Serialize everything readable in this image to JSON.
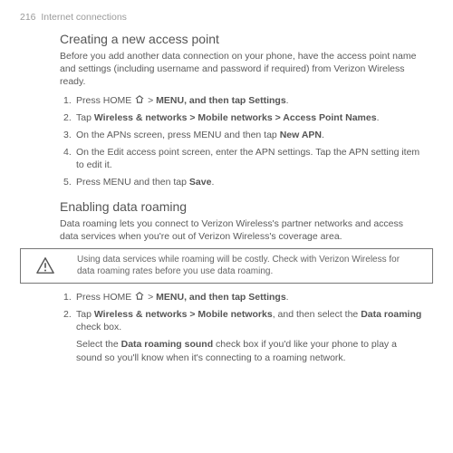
{
  "header": {
    "page_number": "216",
    "section": "Internet connections"
  },
  "s1": {
    "title": "Creating a new access point",
    "desc": "Before you add another data connection on your phone, have the access point name and settings (including username and password if required) from Verizon Wireless ready.",
    "steps": {
      "n1": "1.",
      "t1a": "Press HOME ",
      "t1b": " > ",
      "menu": "MENU, and then tap Settings",
      "t1c": ".",
      "n2": "2.",
      "t2a": "Tap ",
      "path2": "Wireless & networks > Mobile networks > Access Point Names",
      "t2b": ".",
      "n3": "3.",
      "t3a": "On the APNs screen, press MENU and then tap ",
      "newapn": "New APN",
      "t3b": ".",
      "n4": "4.",
      "t4": "On the Edit access point screen, enter the APN settings. Tap the APN setting item to edit it.",
      "n5": "5.",
      "t5a": "Press MENU and then tap ",
      "save": "Save",
      "t5b": "."
    }
  },
  "s2": {
    "title": "Enabling data roaming",
    "desc": "Data roaming lets you connect to Verizon Wireless's partner networks and access data services when you're out of Verizon Wireless's coverage area.",
    "warning": "Using data services while roaming will be costly. Check with Verizon Wireless for data roaming rates before you use data roaming.",
    "steps": {
      "n1": "1.",
      "t1a": "Press HOME ",
      "t1b": " > ",
      "menu": "MENU, and then tap Settings",
      "t1c": ".",
      "n2": "2.",
      "t2a": "Tap ",
      "path2": "Wireless & networks > Mobile networks",
      "t2b": ", and then select the ",
      "droam": "Data roaming",
      "t2c": " check box.",
      "p3a": "Select the ",
      "drs": "Data roaming sound",
      "p3b": " check box if you'd like your phone to play a sound so you'll know when it's connecting to a roaming network."
    }
  }
}
